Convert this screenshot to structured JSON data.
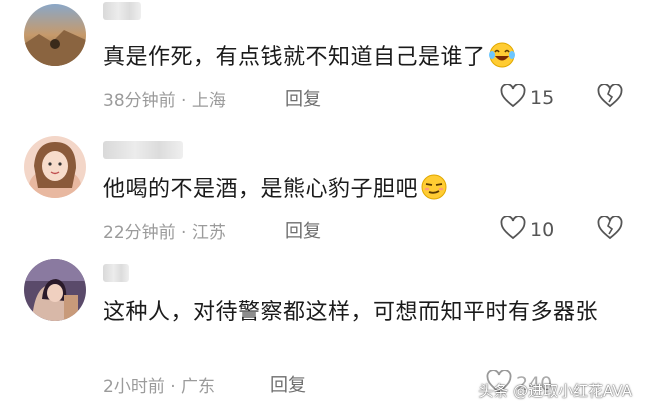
{
  "comments": [
    {
      "text": "真是作死，有点钱就不知道自己是谁了",
      "time": "38分钟前",
      "location": "上海",
      "reply_label": "回复",
      "likes": "15",
      "emoji": "laughing-tears"
    },
    {
      "text": "他喝的不是酒，是熊心豹子胆吧",
      "time": "22分钟前",
      "location": "江苏",
      "reply_label": "回复",
      "likes": "10",
      "emoji": "smirk"
    },
    {
      "text": "这种人，对待警察都这样，可想而知平时有多器张",
      "time": "2小时前",
      "location": "广东",
      "reply_label": "回复",
      "likes": "240"
    }
  ],
  "watermark": "头条 @进取小红花AVA",
  "colors": {
    "text": "#1b1b1b",
    "meta": "#9b9b9b",
    "background": "#ffffff"
  }
}
